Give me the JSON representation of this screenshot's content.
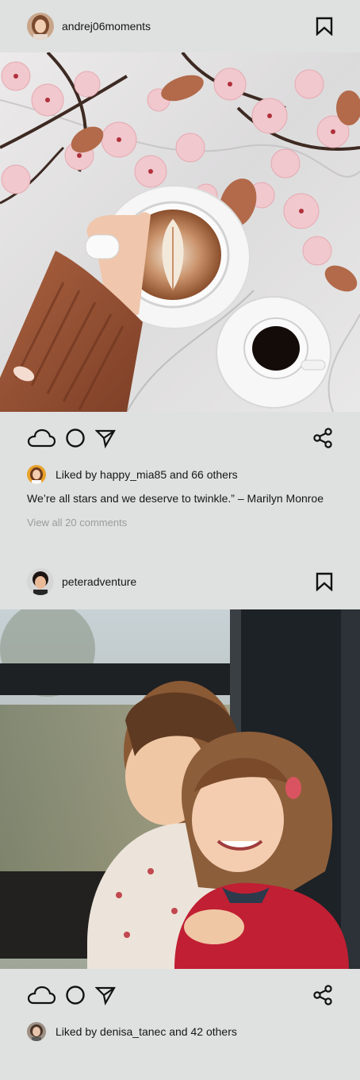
{
  "posts": [
    {
      "username": "andrej06moments",
      "liked_by_prefix": "Liked by ",
      "liked_by_user": "happy_mia85",
      "liked_by_suffix": " and 66 others",
      "caption": "We’re all stars and we deserve to twinkle.” – Marilyn Monroe",
      "view_comments": "View all 20 comments",
      "photo_alt": "latte art coffee and cherry blossoms"
    },
    {
      "username": "peteradventure",
      "liked_by_prefix": "Liked by ",
      "liked_by_user": "denisa_tanec",
      "liked_by_suffix": " and 42 others",
      "photo_alt": "two children looking out a train window"
    }
  ],
  "icons": {
    "like": "cloud-icon",
    "comment": "circle-icon",
    "send": "send-icon",
    "share": "share-icon",
    "save": "bookmark-icon"
  },
  "colors": {
    "background": "#dfe1e0",
    "text": "#161616",
    "muted": "#9a9c9b"
  }
}
